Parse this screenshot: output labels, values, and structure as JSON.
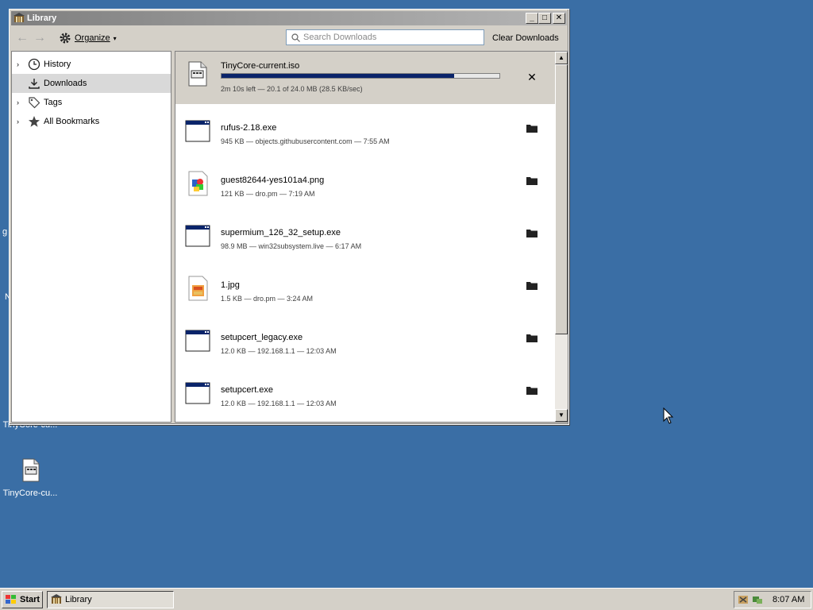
{
  "window": {
    "title": "Library",
    "toolbar": {
      "organize_label": "Organize",
      "search_placeholder": "Search Downloads",
      "clear_label": "Clear Downloads"
    }
  },
  "sidebar": {
    "items": [
      {
        "label": "History",
        "icon": "clock-icon",
        "expandable": true
      },
      {
        "label": "Downloads",
        "icon": "download-icon",
        "expandable": false,
        "selected": true
      },
      {
        "label": "Tags",
        "icon": "tag-icon",
        "expandable": true
      },
      {
        "label": "All Bookmarks",
        "icon": "star-icon",
        "expandable": true
      }
    ]
  },
  "downloads": {
    "active": {
      "name": "TinyCore-current.iso",
      "status": "2m 10s left — 20.1 of 24.0 MB (28.5 KB/sec)",
      "progress": 0.8375,
      "action": "cancel-icon"
    },
    "items": [
      {
        "name": "rufus-2.18.exe",
        "meta": "945 KB — objects.githubusercontent.com — 7:55 AM",
        "icon": "exe-file-icon"
      },
      {
        "name": "guest82644-yes101a4.png",
        "meta": "121 KB — dro.pm — 7:19 AM",
        "icon": "image-file-icon"
      },
      {
        "name": "supermium_126_32_setup.exe",
        "meta": "98.9 MB — win32subsystem.live — 6:17 AM",
        "icon": "exe-file-icon"
      },
      {
        "name": "1.jpg",
        "meta": "1.5 KB — dro.pm — 3:24 AM",
        "icon": "image-file-icon"
      },
      {
        "name": "setupcert_legacy.exe",
        "meta": "12.0 KB — 192.168.1.1 — 12:03 AM",
        "icon": "exe-file-icon"
      },
      {
        "name": "setupcert.exe",
        "meta": "12.0 KB — 192.168.1.1 — 12:03 AM",
        "icon": "exe-file-icon"
      }
    ]
  },
  "desktop": {
    "icons": [
      {
        "label": "TinyCore-cu..."
      },
      {
        "label": "TinyCore-cu..."
      }
    ],
    "fragments": [
      "g",
      "N"
    ]
  },
  "taskbar": {
    "start_label": "Start",
    "task_label": "Library",
    "clock": "8:07 AM"
  },
  "colors": {
    "desktop": "#3a6ea5",
    "progress": "#0a246a",
    "selected_row": "#d9d9d9"
  }
}
